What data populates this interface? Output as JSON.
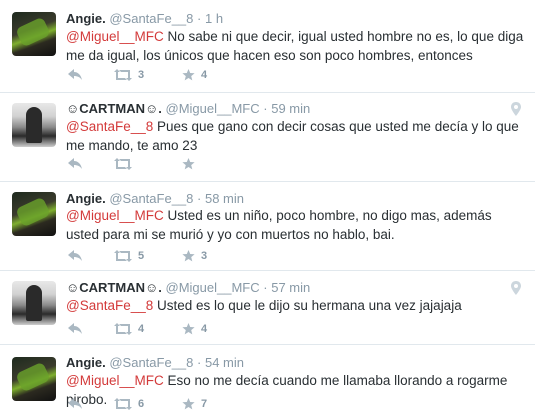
{
  "tweets": [
    {
      "name": "Angie.",
      "handle": "@SantaFe__8",
      "time": "1 h",
      "mention": "@Miguel__MFC",
      "text": " No sabe ni que decir, igual usted hombre no es, lo que diga me da igual, los únicos que hacen eso son poco hombres, entonces",
      "retweets": "3",
      "favorites": "4",
      "avatar": "angie"
    },
    {
      "name": "☺CARTMAN☺.",
      "handle": "@Miguel__MFC",
      "time": "59 min",
      "mention": "@SantaFe__8",
      "text": " Pues que gano con decir cosas que usted me decía y lo que me mando, te amo 23",
      "retweets": "",
      "favorites": "",
      "avatar": "cartman",
      "has_location": true
    },
    {
      "name": "Angie.",
      "handle": "@SantaFe__8",
      "time": "58 min",
      "mention": "@Miguel__MFC",
      "text": " Usted es un niño, poco hombre, no digo mas,  además usted para mi se murió y yo con muertos no hablo, bai.",
      "retweets": "5",
      "favorites": "3",
      "avatar": "angie"
    },
    {
      "name": "☺CARTMAN☺.",
      "handle": "@Miguel__MFC",
      "time": "57 min",
      "mention": "@SantaFe__8",
      "text": " Usted es lo que le dijo su hermana una vez jajajaja",
      "retweets": "4",
      "favorites": "4",
      "avatar": "cartman",
      "has_location": true
    },
    {
      "name": "Angie.",
      "handle": "@SantaFe__8",
      "time": "54 min",
      "mention": "@Miguel__MFC",
      "text": " Eso no me decía cuando me llamaba llorando a rogarme pirobo.",
      "retweets": "6",
      "favorites": "7",
      "avatar": "angie"
    }
  ],
  "icons": {
    "reply": "reply-icon",
    "retweet": "retweet-icon",
    "favorite": "star-icon",
    "location": "location-pin-icon"
  },
  "colors": {
    "mention": "#d33a3a",
    "meta": "#8899a6",
    "text": "#292f33"
  }
}
